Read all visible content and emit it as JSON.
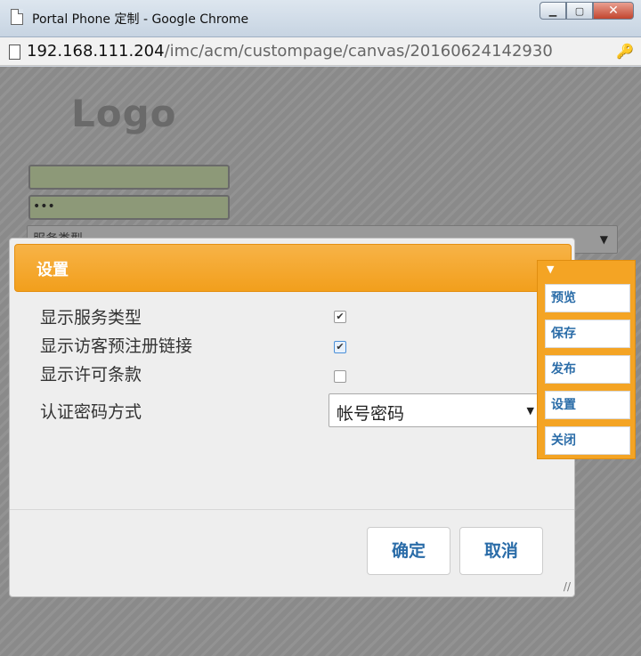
{
  "window": {
    "title": "Portal Phone 定制 - Google Chrome",
    "minimize_icon": "minimize-icon",
    "maximize_icon": "maximize-icon",
    "close_icon": "close-icon"
  },
  "addressbar": {
    "url_host": "192.168.111.204",
    "url_path": "/imc/acm/custompage/canvas/20160624142930"
  },
  "page": {
    "logo": "Logo",
    "username_value": "",
    "password_value": "•••",
    "service_placeholder": "服务类型"
  },
  "dialog": {
    "title": "设置",
    "options": [
      {
        "label": "显示服务类型",
        "checked": true
      },
      {
        "label": "显示访客预注册链接",
        "checked": true
      },
      {
        "label": "显示许可条款",
        "checked": false
      }
    ],
    "auth_label": "认证密码方式",
    "auth_value": "帐号密码",
    "ok_label": "确定",
    "cancel_label": "取消"
  },
  "toolbar": {
    "pin_icon": "pin-icon",
    "items": [
      "预览",
      "保存",
      "发布",
      "设置",
      "关闭"
    ]
  },
  "colors": {
    "accent_orange": "#f29f1c",
    "link_blue": "#2a6ca8"
  }
}
